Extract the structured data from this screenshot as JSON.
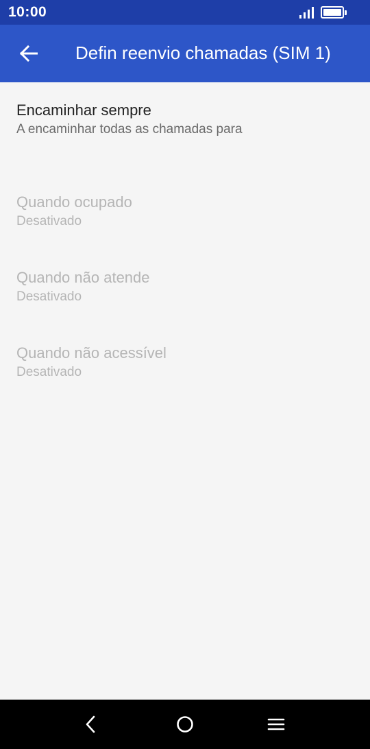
{
  "status_bar": {
    "time": "10:00",
    "icons": [
      "signal-icon",
      "battery-icon"
    ]
  },
  "app_bar": {
    "back_icon": "arrow-left-icon",
    "title": "Defin reenvio chamadas (SIM 1)"
  },
  "preferences": [
    {
      "title": "Encaminhar sempre",
      "summary": "A encaminhar todas as chamadas para",
      "enabled": true
    },
    {
      "title": "Quando ocupado",
      "summary": "Desativado",
      "enabled": false
    },
    {
      "title": "Quando não atende",
      "summary": "Desativado",
      "enabled": false
    },
    {
      "title": "Quando não acessível",
      "summary": "Desativado",
      "enabled": false
    }
  ],
  "nav_bar": {
    "icons": [
      "back-triangle-icon",
      "home-circle-icon",
      "menu-lines-icon"
    ]
  },
  "colors": {
    "status_bar": "#1e3ea8",
    "app_bar": "#2d56c8",
    "background": "#f5f5f5",
    "text_primary": "#212121",
    "text_secondary": "#6b6b6b",
    "text_disabled": "#b5b5b5"
  }
}
